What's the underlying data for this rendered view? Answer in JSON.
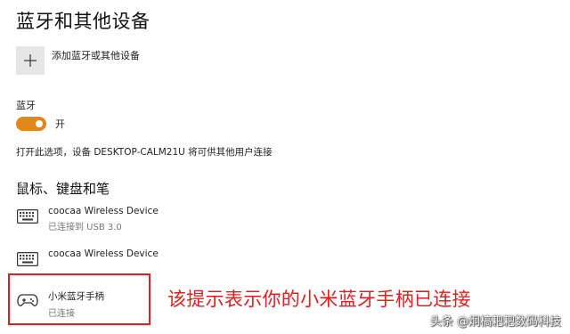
{
  "header": {
    "title": "蓝牙和其他设备"
  },
  "add_device": {
    "icon": "plus-icon",
    "label": "添加蓝牙或其他设备"
  },
  "bluetooth": {
    "label": "蓝牙",
    "toggle_state": "开",
    "toggle_on": true,
    "accent_color": "#e4861c"
  },
  "discoverable_text": "打开此选项，设备 DESKTOP-CALM21U 将可供其他用户连接",
  "mouse_keyboard_pen": {
    "heading": "鼠标、键盘和笔",
    "devices": [
      {
        "icon": "keyboard-icon",
        "name": "coocaa Wireless Device",
        "status": "已连接到 USB 3.0"
      },
      {
        "icon": "keyboard-icon",
        "name": "coocaa Wireless Device",
        "status": ""
      },
      {
        "icon": "gamepad-icon",
        "name": "小米蓝牙手柄",
        "status": "已连接"
      }
    ]
  },
  "annotation": {
    "text": "该提示表示你的小米蓝牙手柄已连接",
    "color": "#e02020"
  },
  "watermark": {
    "text": "头条 @炯槁耙耙数码科技"
  }
}
